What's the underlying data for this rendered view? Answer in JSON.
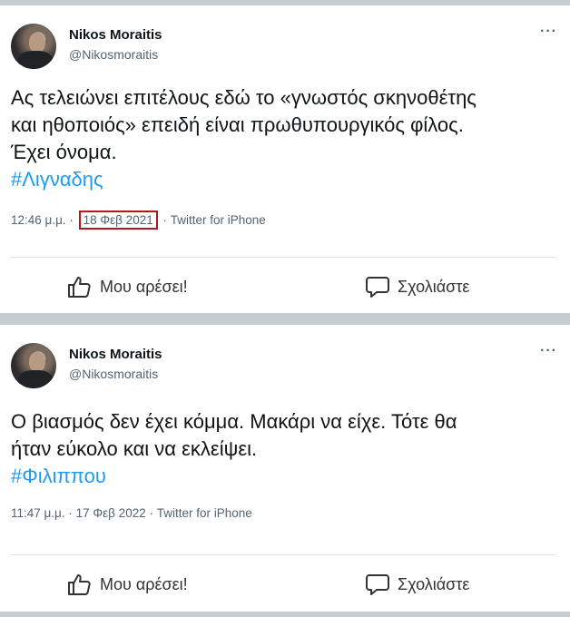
{
  "tweets": [
    {
      "author_name": "Nikos Moraitis",
      "author_handle": "@Nikosmoraitis",
      "more_label": "···",
      "text_lines": [
        "Ας τελειώνει επιτέλους εδώ το «γνωστός σκηνοθέτης",
        "και ηθοποιός» επειδή είναι πρωθυπουργικός φίλος.",
        "Έχει όνομα."
      ],
      "hashtag": "#Λιγναδης",
      "time": "12:46 μ.μ. ·",
      "date": "18 Φεβ 2021",
      "source": "· Twitter for iPhone",
      "date_highlighted": true,
      "like_label": "Μου αρέσει!",
      "comment_label": "Σχολιάστε"
    },
    {
      "author_name": "Nikos Moraitis",
      "author_handle": "@Nikosmoraitis",
      "more_label": "···",
      "text_lines": [
        "Ο βιασμός δεν έχει κόμμα. Μακάρι να είχε. Τότε θα",
        "ήταν εύκολο και να εκλείψει."
      ],
      "hashtag": "#Φιλιππου",
      "time": "11:47 μ.μ. ·",
      "date": "17 Φεβ 2022",
      "source": "· Twitter for iPhone",
      "date_highlighted": false,
      "like_label": "Μου αρέσει!",
      "comment_label": "Σχολιάστε"
    }
  ],
  "colors": {
    "hashtag": "#1d9bf0",
    "highlight_box": "#b3181f",
    "separator": "#c9ccd0",
    "muted_text": "#536471"
  },
  "icons": {
    "like": "thumbs-up-icon",
    "comment": "speech-bubble-icon",
    "more": "more-dots-icon"
  }
}
